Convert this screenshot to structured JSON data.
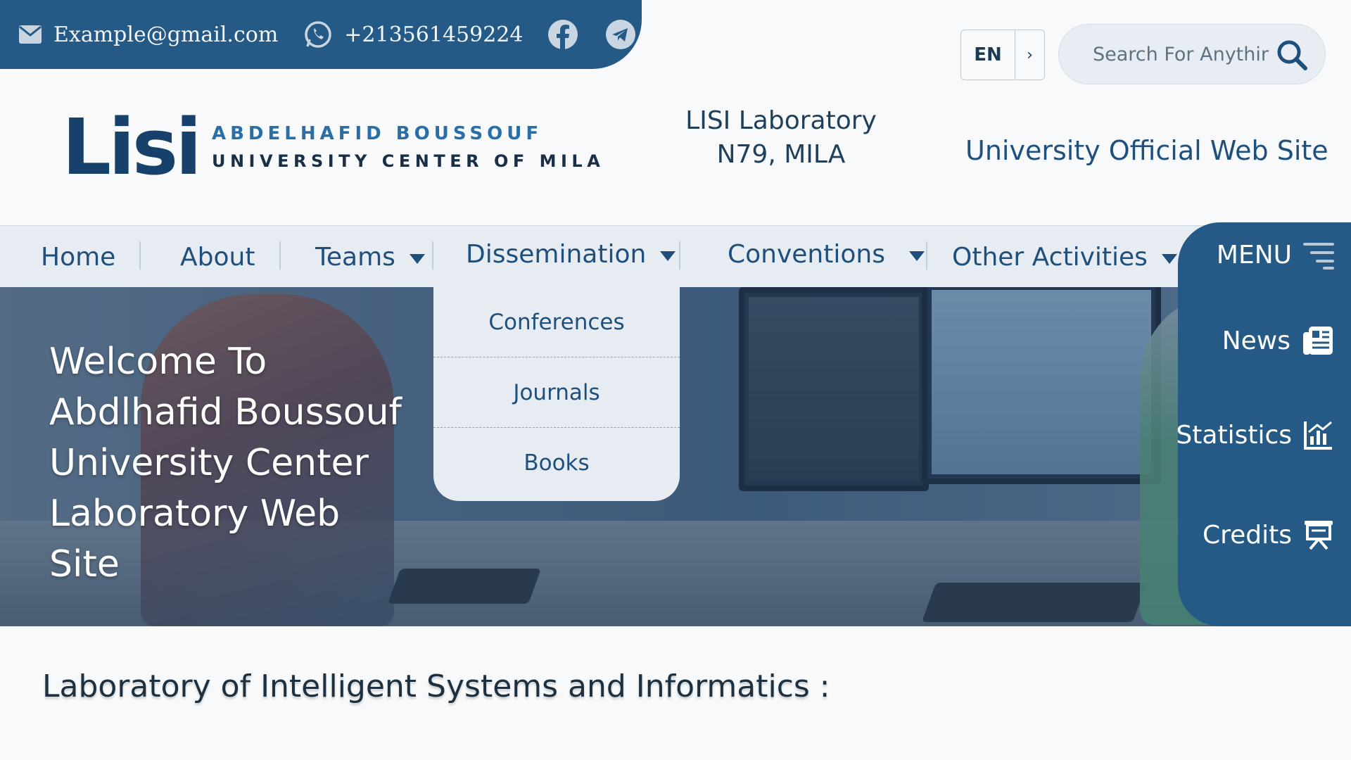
{
  "contact": {
    "email": "Example@gmail.com",
    "phone": "+213561459224"
  },
  "language": {
    "code": "EN",
    "next": "›"
  },
  "search": {
    "placeholder": "Search For Anything"
  },
  "logo": {
    "mark": "Lisi",
    "line1": "ABDELHAFID BOUSSOUF",
    "line2": "UNIVERSITY CENTER OF MILA"
  },
  "header": {
    "lab_line1": "LISI Laboratory",
    "lab_line2": "N79, MILA",
    "official_link": "University Official Web Site"
  },
  "nav": {
    "items": [
      {
        "label": "Home"
      },
      {
        "label": "About"
      },
      {
        "label": "Teams"
      },
      {
        "label": "Dissemination"
      },
      {
        "label": "Conventions"
      },
      {
        "label": "Other Activities"
      }
    ]
  },
  "dropdown": {
    "options": [
      "Conferences",
      "Journals",
      "Books"
    ]
  },
  "hero": {
    "welcome_lines": [
      "Welcome To",
      "Abdlhafid Boussouf",
      "University Center",
      "Laboratory Web",
      "Site"
    ]
  },
  "sidemenu": {
    "title": "MENU",
    "items": [
      {
        "label": "News",
        "icon": "newspaper-icon"
      },
      {
        "label": "Statistics",
        "icon": "chart-icon"
      },
      {
        "label": "Credits",
        "icon": "presentation-icon"
      }
    ]
  },
  "main": {
    "heading": "Laboratory of Intelligent Systems and Informatics :"
  },
  "colors": {
    "primary": "#255a86",
    "nav_bg": "#e6ecf1",
    "text_dark": "#1c3040"
  }
}
